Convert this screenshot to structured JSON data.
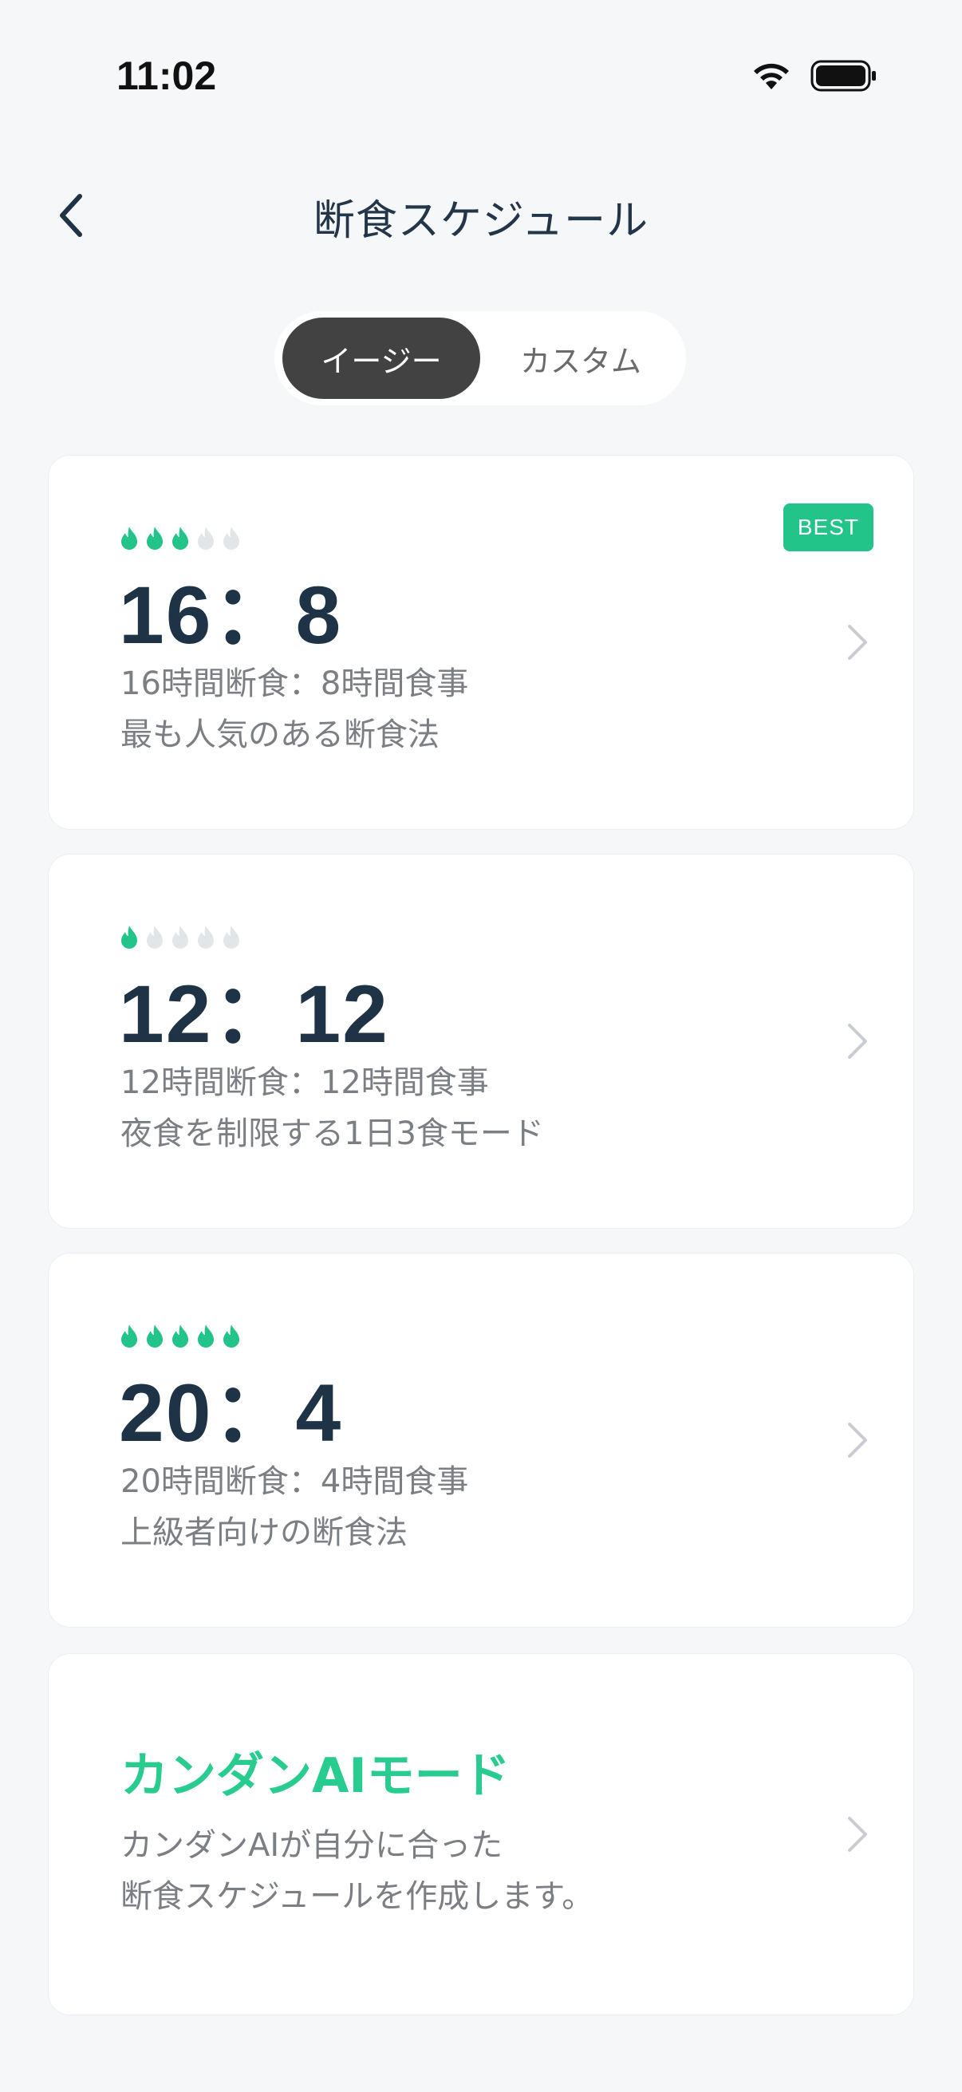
{
  "status_bar": {
    "time": "11:02"
  },
  "header": {
    "title": "断食スケジュール",
    "back_icon": "chevron-left-icon"
  },
  "segmented": {
    "options": [
      "イージー",
      "カスタム"
    ],
    "selected": "イージー"
  },
  "colors": {
    "accent": "#27cc8e",
    "flame_active": "#22c48a",
    "flame_inactive": "#e3e6e8",
    "title": "#1f3346",
    "muted": "#7b7f84"
  },
  "plans": [
    {
      "ratio": "16：8",
      "line1": "16時間断食：8時間食事",
      "line2": "最も人気のある断食法",
      "difficulty": 3,
      "max_difficulty": 5,
      "badge": "BEST"
    },
    {
      "ratio": "12：12",
      "line1": "12時間断食：12時間食事",
      "line2": "夜食を制限する1日3食モード",
      "difficulty": 1,
      "max_difficulty": 5
    },
    {
      "ratio": "20：4",
      "line1": "20時間断食：4時間食事",
      "line2": "上級者向けの断食法",
      "difficulty": 5,
      "max_difficulty": 5
    }
  ],
  "ai_mode": {
    "title": "カンダンAIモード",
    "line1": "カンダンAIが自分に合った",
    "line2": "断食スケジュールを作成します。"
  }
}
